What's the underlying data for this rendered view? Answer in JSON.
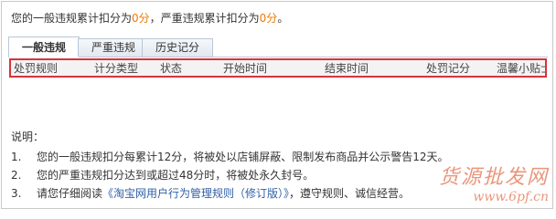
{
  "summary": {
    "prefix": "您的一般违规累计扣分为",
    "general_score": "0分",
    "middle": "，严重违规累计扣分为",
    "serious_score": "0分",
    "suffix": "。"
  },
  "tabs": [
    {
      "label": "一般违规",
      "active": true
    },
    {
      "label": "严重违规",
      "active": false
    },
    {
      "label": "历史记分",
      "active": false
    }
  ],
  "table": {
    "columns": [
      "处罚规则",
      "计分类型",
      "状态",
      "开始时间",
      "结束时间",
      "处罚记分",
      "温馨小贴士"
    ]
  },
  "notes": {
    "title": "说明：",
    "items": [
      {
        "num": "1.",
        "text": "您的一般违规扣分每累计12分，将被处以店铺屏蔽、限制发布商品并公示警告12天。"
      },
      {
        "num": "2.",
        "text": "您的严重违规扣分达到或超过48分时，将被处永久封号。"
      },
      {
        "num": "3.",
        "text_before": "请您仔细阅读",
        "link": "《淘宝网用户行为管理规则（修订版）》",
        "text_after": "，遵守规则、诚信经营。"
      }
    ]
  },
  "watermark": {
    "title": "货源批发网",
    "url": "www.6pf.cn"
  }
}
